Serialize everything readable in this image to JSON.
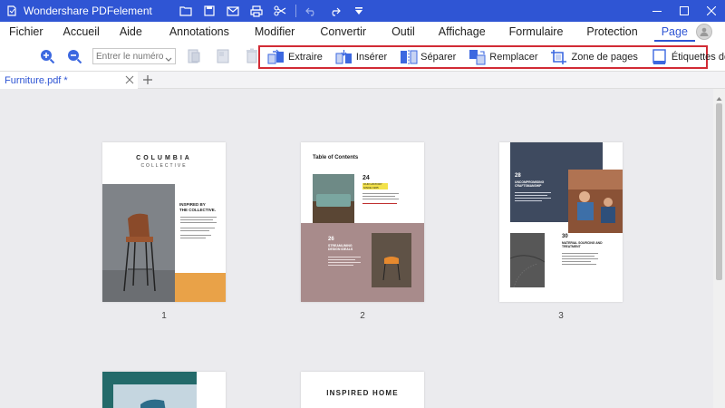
{
  "app": {
    "title": "Wondershare PDFelement"
  },
  "colors": {
    "accent": "#2f55d4",
    "highlight_border": "#d22b35"
  },
  "menu": {
    "items": [
      "Fichier",
      "Accueil",
      "Aide",
      "Annotations",
      "Modifier",
      "Convertir",
      "Outil",
      "Affichage",
      "Formulaire",
      "Protection",
      "Page"
    ],
    "active": "Page"
  },
  "toolbar": {
    "page_number_placeholder": "Entrer le numéro ...",
    "page_tools": [
      {
        "label": "Extraire",
        "icon": "extract-icon"
      },
      {
        "label": "Insérer",
        "icon": "insert-icon"
      },
      {
        "label": "Séparer",
        "icon": "split-icon"
      },
      {
        "label": "Remplacer",
        "icon": "replace-icon"
      },
      {
        "label": "Zone de pages",
        "icon": "crop-pages-icon"
      },
      {
        "label": "Étiquettes de page",
        "icon": "page-labels-icon"
      }
    ]
  },
  "document_tab": {
    "name": "Furniture.pdf *"
  },
  "pages": [
    {
      "number": "1",
      "brand": "COLUMBIA",
      "subtitle": "COLLECTIVE",
      "headline": [
        "INSPIRED BY",
        "THE COLLECTIVE."
      ]
    },
    {
      "number": "2",
      "title": "Table of Contents",
      "entries": [
        {
          "num": "24",
          "label": "OUR HISTORY SINCE 1965"
        },
        {
          "num": "26",
          "label": "STREAMLINING DESIGN IDEALS"
        }
      ]
    },
    {
      "number": "3",
      "entries": [
        {
          "num": "28",
          "label": "UNCOMPROMISING CRAFTSMANSHIP"
        },
        {
          "num": "30",
          "label": "MATERIAL SOURCING AND TREATMENT"
        }
      ]
    },
    {
      "number": ""
    },
    {
      "number": "",
      "title": "INSPIRED HOME"
    }
  ]
}
